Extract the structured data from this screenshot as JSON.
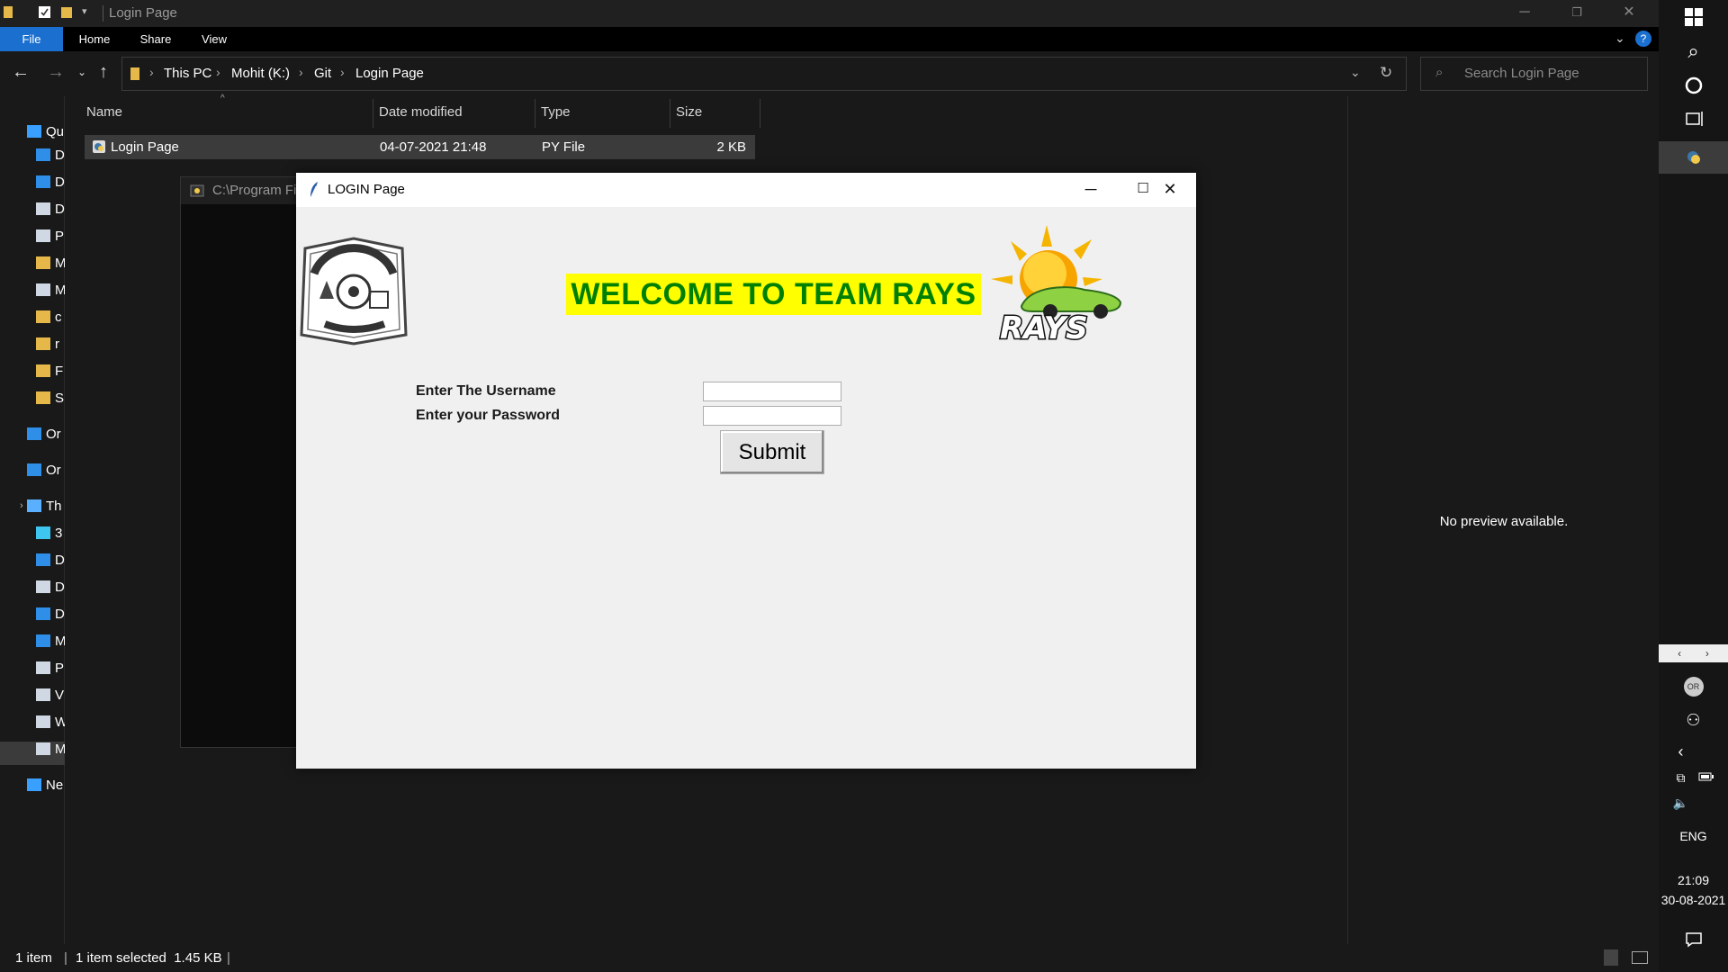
{
  "explorer": {
    "window_title": "Login Page",
    "ribbon_tabs": [
      "File",
      "Home",
      "Share",
      "View"
    ],
    "breadcrumb": [
      "This PC",
      "Mohit (K:)",
      "Git",
      "Login Page"
    ],
    "search_placeholder": "Search Login Page",
    "columns": [
      "Name",
      "Date modified",
      "Type",
      "Size"
    ],
    "files": [
      {
        "name": "Login Page",
        "date_modified": "04-07-2021 21:48",
        "type": "PY File",
        "size": "2 KB"
      }
    ],
    "nav_items": [
      {
        "label": "Qu",
        "icon": "star-icon"
      },
      {
        "label": "D",
        "icon": "desktop-icon"
      },
      {
        "label": "D",
        "icon": "download-icon"
      },
      {
        "label": "D",
        "icon": "document-icon"
      },
      {
        "label": "P",
        "icon": "picture-icon"
      },
      {
        "label": "M",
        "icon": "folder-icon"
      },
      {
        "label": "M",
        "icon": "drive-icon"
      },
      {
        "label": "c",
        "icon": "folder-icon"
      },
      {
        "label": "r",
        "icon": "folder-icon"
      },
      {
        "label": "F",
        "icon": "folder-icon"
      },
      {
        "label": "S",
        "icon": "folder-icon"
      },
      {
        "label": "Or",
        "icon": "cloud-icon"
      },
      {
        "label": "Or",
        "icon": "cloud-icon"
      },
      {
        "label": "Th",
        "icon": "computer-icon"
      },
      {
        "label": "3",
        "icon": "cube-icon"
      },
      {
        "label": "D",
        "icon": "desktop-icon"
      },
      {
        "label": "D",
        "icon": "document-icon"
      },
      {
        "label": "D",
        "icon": "download-icon"
      },
      {
        "label": "M",
        "icon": "music-icon"
      },
      {
        "label": "P",
        "icon": "picture-icon"
      },
      {
        "label": "V",
        "icon": "video-icon"
      },
      {
        "label": "W",
        "icon": "drive-icon"
      },
      {
        "label": "M",
        "icon": "drive-icon"
      },
      {
        "label": "Ne",
        "icon": "network-icon"
      }
    ],
    "preview_text": "No preview available.",
    "status": {
      "count": "1 item",
      "selected": "1 item selected  1.45 KB"
    }
  },
  "console_window": {
    "title": "C:\\Program Fi"
  },
  "login_window": {
    "title": "LOGIN Page",
    "welcome": "WELCOME TO TEAM RAYS",
    "logo_text": "RAYS",
    "username_label": "Enter The Username",
    "password_label": "Enter your Password",
    "username_value": "",
    "password_value": "",
    "submit_label": "Submit"
  },
  "taskbar": {
    "language": "ENG",
    "time": "21:09",
    "date": "30-08-2021",
    "avatar_initials": "OR"
  },
  "colors": {
    "file_tab": "#1a6fcf",
    "welcome_bg": "#ffff00",
    "welcome_text": "#008000",
    "explorer_bg": "#191919"
  }
}
